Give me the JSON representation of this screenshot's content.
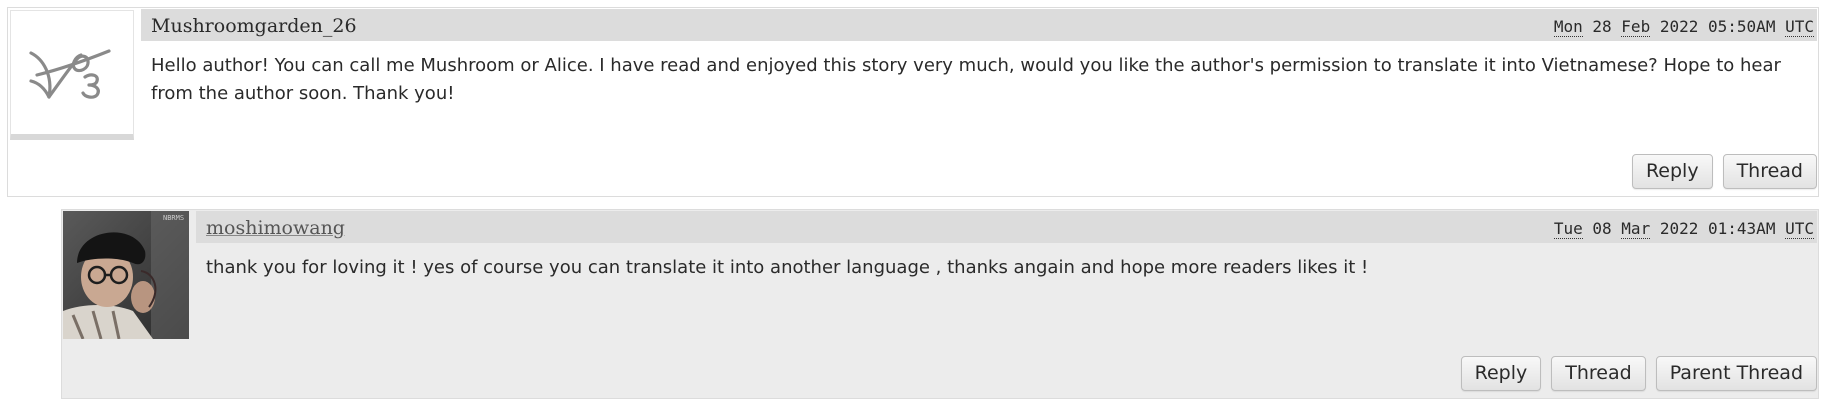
{
  "comments": [
    {
      "author": "Mushroomgarden_26",
      "date_parts": {
        "weekday": "Mon",
        "day": "28",
        "month": "Feb",
        "year": "2022",
        "time": "05:50AM",
        "tz": "UTC"
      },
      "body": "Hello author! You can call me Mushroom or Alice. I have read and enjoyed this story very much, would you like the author's permission to translate it into Vietnamese? Hope to hear from the author soon. Thank you!",
      "actions": [
        "Reply",
        "Thread"
      ]
    },
    {
      "author": "moshimowang",
      "date_parts": {
        "weekday": "Tue",
        "day": "08",
        "month": "Mar",
        "year": "2022",
        "time": "01:43AM",
        "tz": "UTC"
      },
      "body": "thank you for loving it ! yes of course you can translate it into another language , thanks angain and hope more readers likes it !",
      "actions": [
        "Reply",
        "Thread",
        "Parent Thread"
      ]
    }
  ],
  "icons": {
    "default_avatar": "ao3-logo-icon",
    "user_avatar": "user-photo-avatar"
  },
  "colors": {
    "header_bg": "#dcdcdc",
    "reply_bg": "#ececec",
    "text": "#2a2a2a"
  }
}
